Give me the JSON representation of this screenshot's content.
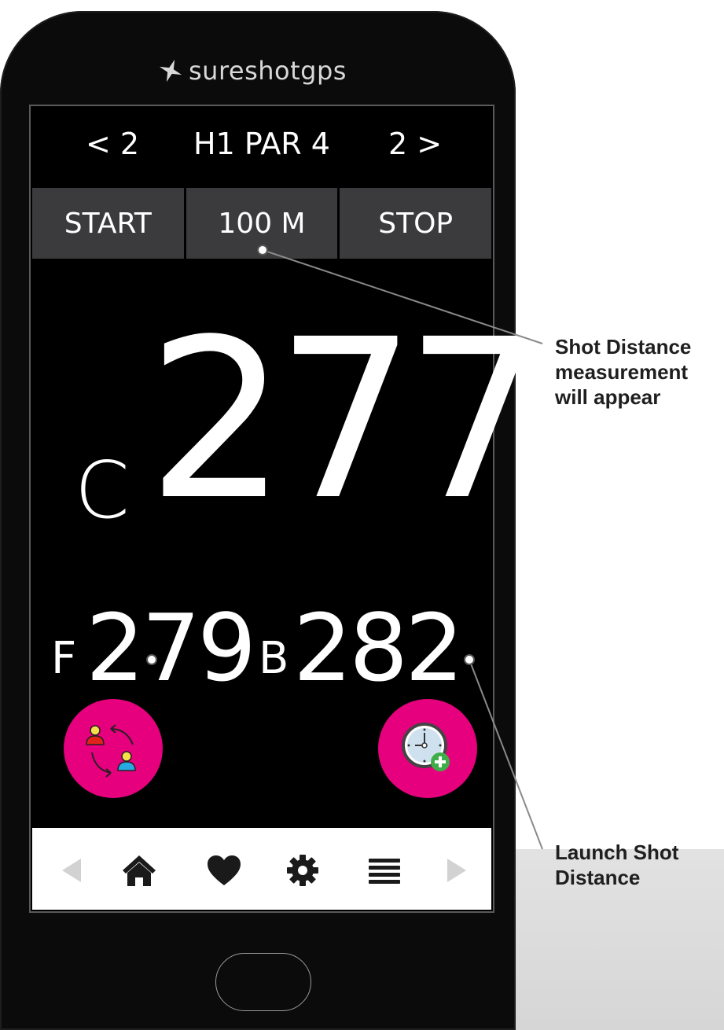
{
  "brand": {
    "logo_text": "sureshotgps"
  },
  "hole_nav": {
    "prev": "< 2",
    "title": "H1 PAR 4",
    "next": "2 >"
  },
  "buttons": {
    "start": "START",
    "distance": "100 M",
    "stop": "STOP"
  },
  "distances": {
    "center_prefix": "C",
    "center_value": "277",
    "front_prefix": "F",
    "front_value": "279",
    "back_prefix": "B",
    "back_value": "282"
  },
  "action_buttons": [
    {
      "icon": "swap-players-icon"
    },
    {
      "icon": "shot-distance-timer-icon"
    }
  ],
  "bottom_nav": {
    "items": [
      {
        "icon": "left-arrow-icon"
      },
      {
        "icon": "home-icon"
      },
      {
        "icon": "heart-icon"
      },
      {
        "icon": "gear-icon"
      },
      {
        "icon": "menu-icon"
      },
      {
        "icon": "right-arrow-icon"
      }
    ]
  },
  "callouts": {
    "shot_distance": [
      "Shot Distance",
      "measurement",
      "will appear"
    ],
    "launch": [
      "Launch Shot",
      "Distance"
    ]
  },
  "colors": {
    "accent_pink": "#e6007e",
    "button_gray": "#3b3b3d",
    "screen_bg": "#000000",
    "nav_bg": "#ffffff",
    "plus_green": "#3fae49"
  }
}
